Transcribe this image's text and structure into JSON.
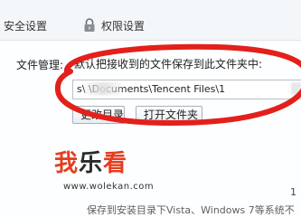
{
  "tabs": {
    "security": "安全设置",
    "permissions": "权限设置"
  },
  "files": {
    "label": "文件管理:",
    "description": "默认把接收到的文件保存到此文件夹中:",
    "path_value": "s\\        \\Documents\\Tencent Files\\1",
    "change_dir_button": "更改目录",
    "open_folder_button": "打开文件夹"
  },
  "watermark": {
    "title_part1": "我",
    "title_part2": "乐",
    "title_part3": "看",
    "url": "www.wolekan.com"
  },
  "bottom": {
    "text": "保存到安装目录下Vista、Windows 7等系统不"
  },
  "side": {
    "glyph": "1"
  },
  "colors": {
    "highlight_ellipse": "#e3201b",
    "watermark_red": "#e63d1f"
  }
}
